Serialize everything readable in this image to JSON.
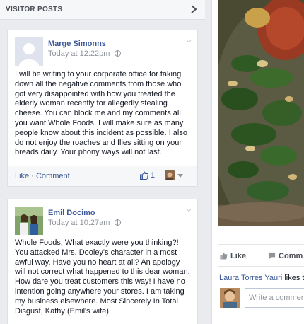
{
  "visitor_posts": {
    "title": "VISITOR POSTS",
    "posts": [
      {
        "author": "Marge Simonns",
        "timestamp": "Today at 12:22pm",
        "body": "I will be writing to your corporate office for taking down all the negative comments from those who got very disappointed with how you treated the elderly woman recently for allegedly stealing cheese. You can block me and my comments all you want Whole Foods. I will make sure as many people know about this incident as possible. I also do not enjoy the roaches and flies sitting on your breads daily. Your phony ways will not last.",
        "like_label": "Like",
        "separator": "·",
        "comment_label": "Comment",
        "like_count": "1"
      },
      {
        "author": "Emil Docimo",
        "timestamp": "Today at 10:27am",
        "body": "Whole Foods, What exactly were you thinking?! You attacked Mrs. Dooley's character in a most awful way. Have you no heart at all? An apology will not correct what happened to this dear woman. How dare you treat customers this way! I have no intention going anywhere your stores. I am taking my business elsewhere. Most Sincerely In Total Disgust, Kathy (Emil's wife)"
      }
    ]
  },
  "photo_panel": {
    "like_label": "Like",
    "comment_label": "Comm",
    "like_activity_name": "Laura Torres Yauri",
    "like_activity_text": " likes t",
    "comment_placeholder": "Write a comment"
  },
  "colors": {
    "link": "#3b5998",
    "meta": "#90949c",
    "background": "#e9ebee"
  }
}
